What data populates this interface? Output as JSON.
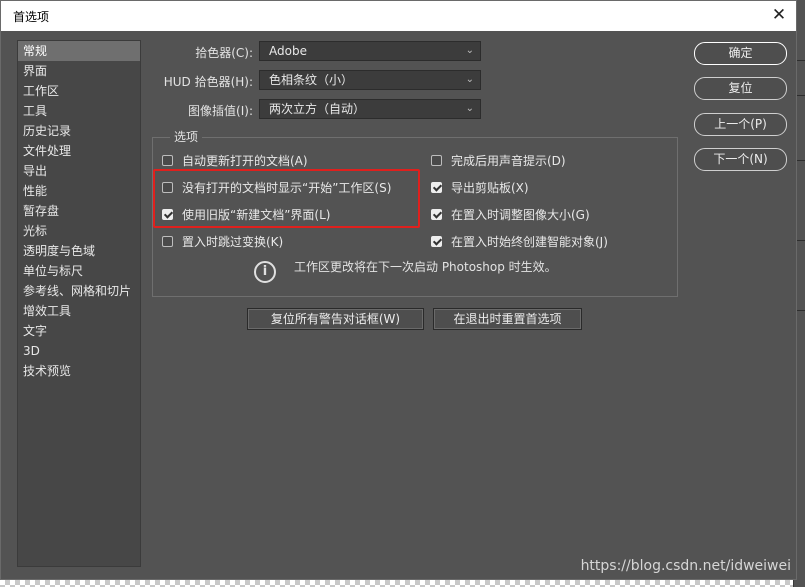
{
  "window": {
    "title": "首选项",
    "close_glyph": "✕"
  },
  "sidebar": {
    "items": [
      {
        "label": "常规",
        "selected": true
      },
      {
        "label": "界面"
      },
      {
        "label": "工作区"
      },
      {
        "label": "工具"
      },
      {
        "label": "历史记录"
      },
      {
        "label": "文件处理"
      },
      {
        "label": "导出"
      },
      {
        "label": "性能"
      },
      {
        "label": "暂存盘"
      },
      {
        "label": "光标"
      },
      {
        "label": "透明度与色域"
      },
      {
        "label": "单位与标尺"
      },
      {
        "label": "参考线、网格和切片"
      },
      {
        "label": "增效工具"
      },
      {
        "label": "文字"
      },
      {
        "label": "3D"
      },
      {
        "label": "技术预览"
      }
    ]
  },
  "fields": {
    "color_picker": {
      "label": "拾色器(C):",
      "value": "Adobe"
    },
    "hud_picker": {
      "label": "HUD 拾色器(H):",
      "value": "色相条纹（小）"
    },
    "interpolation": {
      "label": "图像插值(I):",
      "value": "两次立方（自动）"
    }
  },
  "options": {
    "title": "选项",
    "left": [
      {
        "label": "自动更新打开的文档(A)",
        "checked": false
      },
      {
        "label": "没有打开的文档时显示“开始”工作区(S)",
        "checked": false
      },
      {
        "label": "使用旧版“新建文档”界面(L)",
        "checked": true
      },
      {
        "label": "置入时跳过变换(K)",
        "checked": false
      }
    ],
    "right": [
      {
        "label": "完成后用声音提示(D)",
        "checked": false
      },
      {
        "label": "导出剪贴板(X)",
        "checked": true
      },
      {
        "label": "在置入时调整图像大小(G)",
        "checked": true
      },
      {
        "label": "在置入时始终创建智能对象(J)",
        "checked": true
      }
    ],
    "info": "工作区更改将在下一次启动 Photoshop 时生效。",
    "info_icon": "i"
  },
  "buttons": {
    "ok": "确定",
    "reset": "复位",
    "prev": "上一个(P)",
    "next": "下一个(N)",
    "reset_warnings": "复位所有警告对话框(W)",
    "reset_on_quit": "在退出时重置首选项"
  },
  "watermark": "https://blog.csdn.net/idweiwei",
  "colors": {
    "dialog_bg": "#535353",
    "highlight": "#e0201d",
    "selected_item": "#6f6f6f"
  }
}
